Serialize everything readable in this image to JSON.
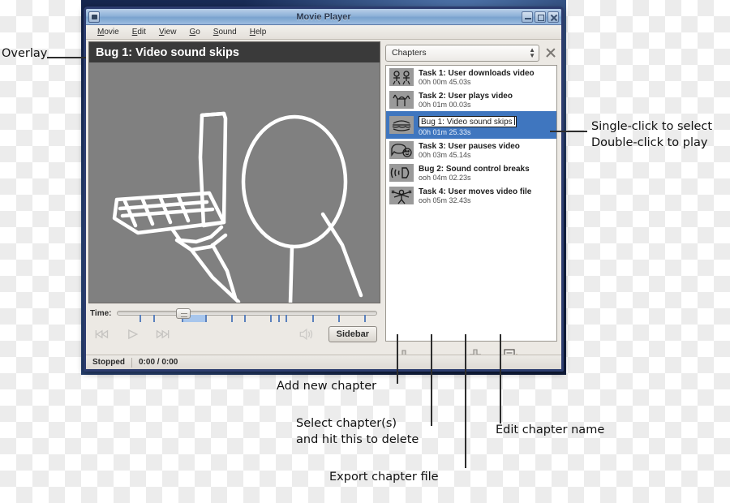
{
  "window": {
    "title": "Movie Player",
    "icon": "app-icon",
    "controls": [
      {
        "name": "minimize",
        "glyph": "minimize-icon"
      },
      {
        "name": "maximize",
        "glyph": "maximize-icon"
      },
      {
        "name": "close",
        "glyph": "close-icon"
      }
    ]
  },
  "menubar": {
    "items": [
      {
        "mnemonic": "M",
        "rest": "ovie"
      },
      {
        "mnemonic": "E",
        "rest": "dit"
      },
      {
        "mnemonic": "V",
        "rest": "iew"
      },
      {
        "mnemonic": "G",
        "rest": "o"
      },
      {
        "mnemonic": "S",
        "rest": "ound"
      },
      {
        "mnemonic": "H",
        "rest": "elp"
      }
    ]
  },
  "video": {
    "overlay_text": "Bug 1: Video sound skips",
    "overlay_bg": "#3a3a3a",
    "canvas_bg": "#808080",
    "drawing": "stick-figure-holding-laptop"
  },
  "time": {
    "label": "Time:",
    "thumb_percent": 23,
    "chapter_fill_start_percent": 25,
    "chapter_fill_end_percent": 34,
    "tick_percents": [
      9,
      14,
      25,
      34,
      44,
      49,
      59,
      62,
      65,
      75,
      85,
      95
    ],
    "fill_color": "#a8c6ec",
    "tick_color": "#5b81bd"
  },
  "transport": {
    "buttons": [
      {
        "name": "previous-chapter",
        "glyph": "skip-back-icon",
        "enabled": false
      },
      {
        "name": "play",
        "glyph": "play-icon",
        "enabled": false
      },
      {
        "name": "next-chapter",
        "glyph": "skip-forward-icon",
        "enabled": false
      }
    ],
    "volume": {
      "name": "volume",
      "glyph": "volume-icon",
      "enabled": false
    },
    "sidebar_button": {
      "mnemonic": "S",
      "rest": "idebar"
    }
  },
  "statusbar": {
    "state": "Stopped",
    "position": "0:00 / 0:00"
  },
  "sidebar": {
    "selector_value": "Chapters",
    "close_label": "close-sidebar",
    "chapters": [
      {
        "title": "Task 1: User downloads video",
        "time": "00h 00m 45.03s",
        "thumb": "two-stick-figures",
        "selected": false,
        "editing": false
      },
      {
        "title": "Task 2: User plays video",
        "time": "00h 01m 00.03s",
        "thumb": "horse-sketch",
        "selected": false,
        "editing": false
      },
      {
        "title": "Bug 1: Video sound skips",
        "time": "00h 01m 25.33s",
        "thumb": "burger-sketch",
        "selected": true,
        "editing": true
      },
      {
        "title": "Task 3: User pauses video",
        "time": "00h 03m 45.14s",
        "thumb": "speech-bubble-smiley",
        "selected": false,
        "editing": false
      },
      {
        "title": "Bug 2: Sound control breaks",
        "time": "ooh 04m 02.23s",
        "thumb": "speaker-waves",
        "selected": false,
        "editing": false
      },
      {
        "title": "Task 4: User moves video file",
        "time": "ooh 05m 32.43s",
        "thumb": "stick-figure-arms",
        "selected": false,
        "editing": false
      }
    ],
    "tools": [
      {
        "name": "add-chapter",
        "glyph": "plus-icon"
      },
      {
        "name": "delete-chapter",
        "glyph": "minus-icon"
      },
      {
        "name": "export-chapter",
        "glyph": "download-icon"
      },
      {
        "name": "edit-chapter",
        "glyph": "edit-pencil-icon"
      }
    ]
  },
  "annotations": {
    "overlay": "Overlay",
    "click_hint": "Single-click to select\nDouble-click to play",
    "add": "Add new chapter",
    "delete": "Select chapter(s)\nand hit this to delete",
    "export": "Export chapter file",
    "edit": "Edit chapter name"
  },
  "colors": {
    "selection_blue": "#3f76bf",
    "window_border": "#2c3c6e",
    "checker_light": "#ffffff",
    "checker_dark": "#ececec"
  }
}
